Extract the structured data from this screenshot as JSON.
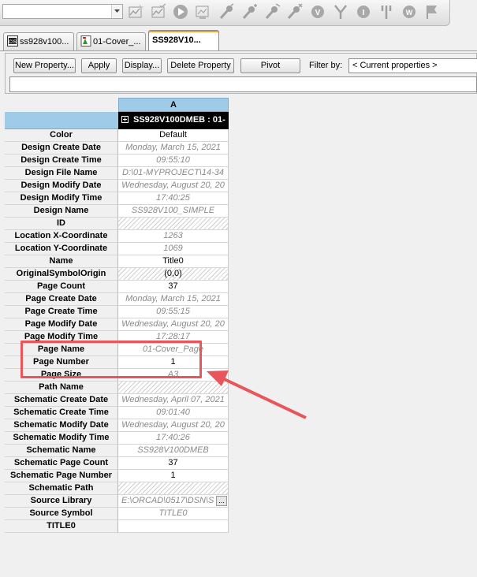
{
  "toolbar": {
    "combo_value": "",
    "icons": [
      "graph-icon",
      "graph-check-icon",
      "play-icon",
      "graph-stop-icon",
      "probe-icon",
      "probe-add-icon",
      "probe-edit-icon",
      "probe-delete-icon",
      "v-marker-icon",
      "voltage-level-icon",
      "i-marker-icon",
      "current-level-icon",
      "w-marker-icon",
      "flag-icon"
    ]
  },
  "tabs": [
    {
      "label": "ss928v100...",
      "icon": "capture-icon"
    },
    {
      "label": "01-Cover_...",
      "icon": "page-icon"
    },
    {
      "label": "SS928V10...",
      "icon": ""
    }
  ],
  "panel": {
    "new_property": "New Property...",
    "apply": "Apply",
    "display": "Display...",
    "delete_property": "Delete Property",
    "pivot": "Pivot",
    "filter_label": "Filter by:",
    "filter_value": "< Current properties >",
    "edit_value": ""
  },
  "grid": {
    "column_header": "A",
    "part_header": "SS928V100DMEB : 01-",
    "rows": [
      {
        "label": "Color",
        "value": "Default",
        "style": "normal"
      },
      {
        "label": "Design Create Date",
        "value": "Monday, March 15, 2021",
        "style": "ro"
      },
      {
        "label": "Design Create Time",
        "value": "09:55:10",
        "style": "ro"
      },
      {
        "label": "Design File Name",
        "value": "D:\\01-MYPROJECT\\14-34",
        "style": "ro"
      },
      {
        "label": "Design Modify Date",
        "value": "Wednesday, August 20, 20",
        "style": "ro"
      },
      {
        "label": "Design Modify Time",
        "value": "17:40:25",
        "style": "ro"
      },
      {
        "label": "Design Name",
        "value": "SS928V100_SIMPLE",
        "style": "ro"
      },
      {
        "label": "ID",
        "value": "",
        "style": "hatch"
      },
      {
        "label": "Location X-Coordinate",
        "value": "1263",
        "style": "ro"
      },
      {
        "label": "Location Y-Coordinate",
        "value": "1069",
        "style": "ro"
      },
      {
        "label": "Name",
        "value": "Title0",
        "style": "normal"
      },
      {
        "label": "OriginalSymbolOrigin",
        "value": "(0,0)",
        "style": "hatchtext"
      },
      {
        "label": "Page Count",
        "value": "37",
        "style": "normal"
      },
      {
        "label": "Page Create Date",
        "value": "Monday, March 15, 2021",
        "style": "ro"
      },
      {
        "label": "Page Create Time",
        "value": "09:55:15",
        "style": "ro"
      },
      {
        "label": "Page Modify Date",
        "value": "Wednesday, August 20, 20",
        "style": "ro"
      },
      {
        "label": "Page Modify Time",
        "value": "17:28:17",
        "style": "ro"
      },
      {
        "label": "Page Name",
        "value": "01-Cover_Page",
        "style": "ro"
      },
      {
        "label": "Page Number",
        "value": "1",
        "style": "normal"
      },
      {
        "label": "Page Size",
        "value": "A3",
        "style": "ro"
      },
      {
        "label": "Path Name",
        "value": "",
        "style": "hatch"
      },
      {
        "label": "Schematic Create Date",
        "value": "Wednesday, April 07, 2021",
        "style": "ro"
      },
      {
        "label": "Schematic Create Time",
        "value": "09:01:40",
        "style": "ro"
      },
      {
        "label": "Schematic Modify Date",
        "value": "Wednesday, August 20, 20",
        "style": "ro"
      },
      {
        "label": "Schematic Modify Time",
        "value": "17:40:26",
        "style": "ro"
      },
      {
        "label": "Schematic Name",
        "value": "SS928V100DMEB",
        "style": "ro"
      },
      {
        "label": "Schematic Page Count",
        "value": "37",
        "style": "normal"
      },
      {
        "label": "Schematic Page Number",
        "value": "1",
        "style": "normal"
      },
      {
        "label": "Schematic Path",
        "value": "",
        "style": "hatch"
      },
      {
        "label": "Source Library",
        "value": "E:\\ORCAD\\0517\\DSN\\S",
        "style": "ro-left-ellipsis"
      },
      {
        "label": "Source Symbol",
        "value": "TITLE0",
        "style": "ro"
      },
      {
        "label": "TITLE0",
        "value": "",
        "style": "normal"
      }
    ]
  },
  "annotation": {
    "color": "#e8555a"
  }
}
